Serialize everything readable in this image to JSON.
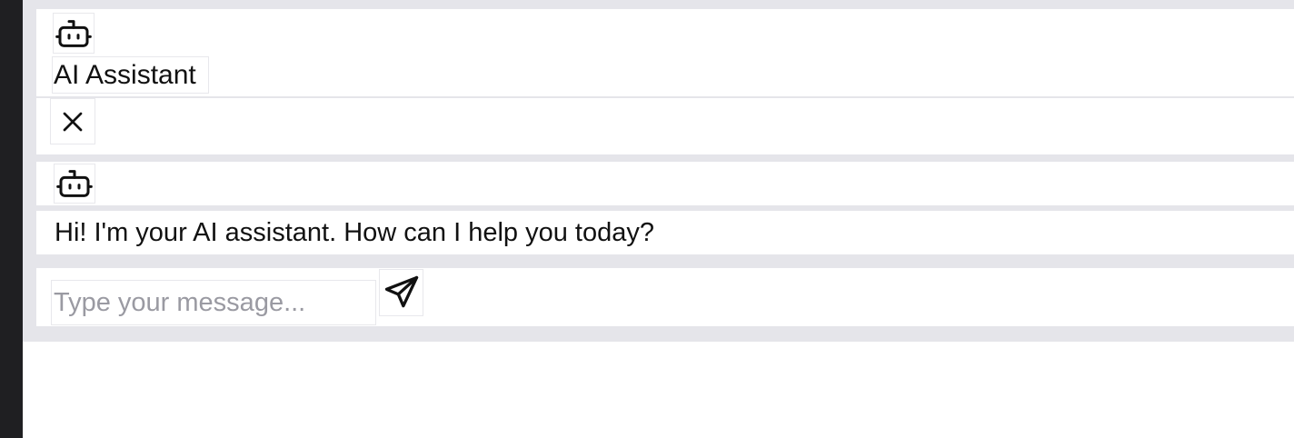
{
  "header": {
    "title": "AI Assistant",
    "icon": "bot-icon"
  },
  "controls": {
    "close_icon": "close-icon",
    "send_icon": "send-icon"
  },
  "messages": [
    {
      "role": "assistant",
      "icon": "bot-icon",
      "text": "Hi! I'm your AI assistant. How can I help you today?"
    }
  ],
  "composer": {
    "placeholder": "Type your message...",
    "value": ""
  },
  "colors": {
    "widget_background": "#e5e5ea",
    "panel_background": "#ffffff",
    "left_rail": "#1f1f22",
    "placeholder": "#9a9aa2",
    "text": "#111111"
  }
}
